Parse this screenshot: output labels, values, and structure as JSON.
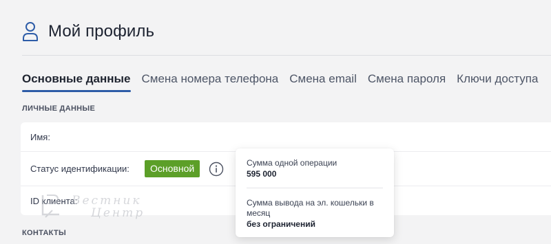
{
  "header": {
    "title": "Мой профиль",
    "icon": "user-icon"
  },
  "tabs": [
    {
      "label": "Основные данные",
      "active": true
    },
    {
      "label": "Смена номера телефона",
      "active": false
    },
    {
      "label": "Смена email",
      "active": false
    },
    {
      "label": "Смена пароля",
      "active": false
    },
    {
      "label": "Ключи доступа",
      "active": false
    }
  ],
  "sections": {
    "personal": "ЛИЧНЫЕ ДАННЫЕ",
    "contacts": "КОНТАКТЫ"
  },
  "personal": {
    "name_label": "Имя:",
    "status_label": "Статус идентификации:",
    "status_value": "Основной",
    "client_id_label": "ID клиента:"
  },
  "tooltip": {
    "item1_label": "Сумма одной операции",
    "item1_value": "595 000",
    "item2_label": "Сумма вывода на эл. кошельки в месяц",
    "item2_value": "без ограничений"
  },
  "watermark": {
    "line1": "Вестник",
    "line2": "Центр"
  },
  "colors": {
    "accent": "#2d5ca7",
    "badge": "#5c9f28",
    "background": "#f3f3f4"
  }
}
